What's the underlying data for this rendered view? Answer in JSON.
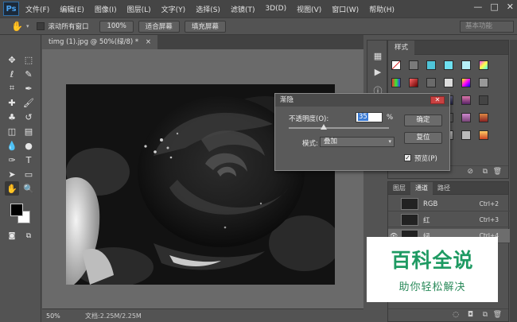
{
  "app": {
    "logo": "Ps"
  },
  "menu": [
    "文件(F)",
    "编辑(E)",
    "图像(I)",
    "图层(L)",
    "文字(Y)",
    "选择(S)",
    "滤镜(T)",
    "3D(D)",
    "视图(V)",
    "窗口(W)",
    "帮助(H)"
  ],
  "window_controls": {
    "minimize": "—",
    "maximize": "□",
    "close": "✕"
  },
  "options_bar": {
    "scroll_all_label": "滚动所有窗口",
    "zoom_button": "100%",
    "fit_screen_button": "适合屏幕",
    "fill_screen_button": "填充屏幕",
    "workspace": "基本功能"
  },
  "document": {
    "tab_title": "timg (1).jpg @ 50%(绿/8) *",
    "tab_close": "×"
  },
  "status": {
    "zoom": "50%",
    "doc_size": "文档:2.25M/2.25M"
  },
  "styles_panel": {
    "tab": "样式"
  },
  "channels_panel": {
    "tabs": [
      "图层",
      "通道",
      "路径"
    ],
    "channels": [
      {
        "name": "RGB",
        "shortcut": "Ctrl+2"
      },
      {
        "name": "红",
        "shortcut": "Ctrl+3"
      },
      {
        "name": "绿",
        "shortcut": "Ctrl+4"
      }
    ]
  },
  "fade_dialog": {
    "title": "渐隐",
    "opacity_label": "不透明度(O):",
    "opacity_value": "35",
    "opacity_unit": "%",
    "mode_label": "模式:",
    "mode_value": "叠加",
    "ok_button": "确定",
    "reset_button": "复位",
    "preview_label": "预览(P)",
    "preview_checked": true,
    "opacity_fraction": 0.35
  },
  "watermark": {
    "brand": "百科全说",
    "slogan": "助你轻松解决"
  },
  "icons": {
    "move": "✥",
    "marquee": "⬚",
    "lasso": "ℓ",
    "quick-select": "✎",
    "crop": "⌗",
    "eyedropper": "✒",
    "healing": "✚",
    "brush": "🖌",
    "stamp": "♣",
    "history-brush": "↺",
    "eraser": "◫",
    "gradient": "▤",
    "blur": "💧",
    "dodge": "●",
    "pen": "✑",
    "type": "T",
    "path-select": "➤",
    "shape": "▭",
    "hand": "✋",
    "zoom": "🔍"
  },
  "colors": {
    "foreground": "#000000",
    "background": "#ffffff",
    "accent": "#2f6ea8",
    "watermark_green": "#1e9a62"
  }
}
